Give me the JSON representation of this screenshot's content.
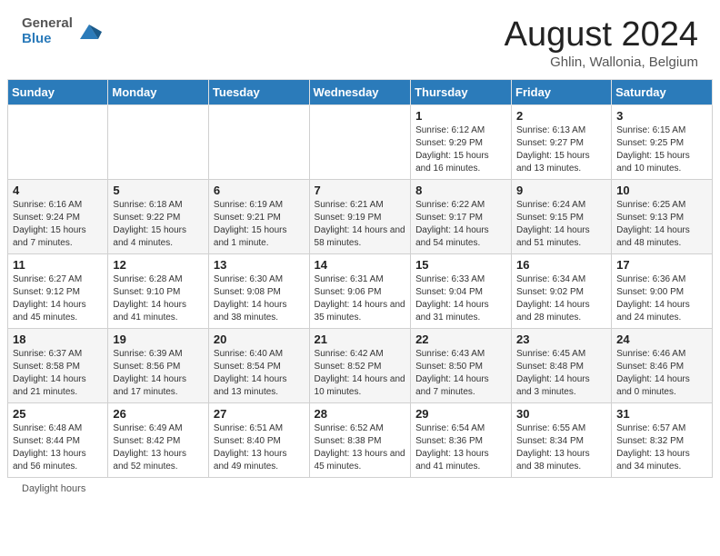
{
  "header": {
    "logo": {
      "general": "General",
      "blue": "Blue"
    },
    "title": "August 2024",
    "location": "Ghlin, Wallonia, Belgium"
  },
  "calendar": {
    "days_of_week": [
      "Sunday",
      "Monday",
      "Tuesday",
      "Wednesday",
      "Thursday",
      "Friday",
      "Saturday"
    ],
    "weeks": [
      [
        {
          "day": "",
          "info": ""
        },
        {
          "day": "",
          "info": ""
        },
        {
          "day": "",
          "info": ""
        },
        {
          "day": "",
          "info": ""
        },
        {
          "day": "1",
          "info": "Sunrise: 6:12 AM\nSunset: 9:29 PM\nDaylight: 15 hours and 16 minutes."
        },
        {
          "day": "2",
          "info": "Sunrise: 6:13 AM\nSunset: 9:27 PM\nDaylight: 15 hours and 13 minutes."
        },
        {
          "day": "3",
          "info": "Sunrise: 6:15 AM\nSunset: 9:25 PM\nDaylight: 15 hours and 10 minutes."
        }
      ],
      [
        {
          "day": "4",
          "info": "Sunrise: 6:16 AM\nSunset: 9:24 PM\nDaylight: 15 hours and 7 minutes."
        },
        {
          "day": "5",
          "info": "Sunrise: 6:18 AM\nSunset: 9:22 PM\nDaylight: 15 hours and 4 minutes."
        },
        {
          "day": "6",
          "info": "Sunrise: 6:19 AM\nSunset: 9:21 PM\nDaylight: 15 hours and 1 minute."
        },
        {
          "day": "7",
          "info": "Sunrise: 6:21 AM\nSunset: 9:19 PM\nDaylight: 14 hours and 58 minutes."
        },
        {
          "day": "8",
          "info": "Sunrise: 6:22 AM\nSunset: 9:17 PM\nDaylight: 14 hours and 54 minutes."
        },
        {
          "day": "9",
          "info": "Sunrise: 6:24 AM\nSunset: 9:15 PM\nDaylight: 14 hours and 51 minutes."
        },
        {
          "day": "10",
          "info": "Sunrise: 6:25 AM\nSunset: 9:13 PM\nDaylight: 14 hours and 48 minutes."
        }
      ],
      [
        {
          "day": "11",
          "info": "Sunrise: 6:27 AM\nSunset: 9:12 PM\nDaylight: 14 hours and 45 minutes."
        },
        {
          "day": "12",
          "info": "Sunrise: 6:28 AM\nSunset: 9:10 PM\nDaylight: 14 hours and 41 minutes."
        },
        {
          "day": "13",
          "info": "Sunrise: 6:30 AM\nSunset: 9:08 PM\nDaylight: 14 hours and 38 minutes."
        },
        {
          "day": "14",
          "info": "Sunrise: 6:31 AM\nSunset: 9:06 PM\nDaylight: 14 hours and 35 minutes."
        },
        {
          "day": "15",
          "info": "Sunrise: 6:33 AM\nSunset: 9:04 PM\nDaylight: 14 hours and 31 minutes."
        },
        {
          "day": "16",
          "info": "Sunrise: 6:34 AM\nSunset: 9:02 PM\nDaylight: 14 hours and 28 minutes."
        },
        {
          "day": "17",
          "info": "Sunrise: 6:36 AM\nSunset: 9:00 PM\nDaylight: 14 hours and 24 minutes."
        }
      ],
      [
        {
          "day": "18",
          "info": "Sunrise: 6:37 AM\nSunset: 8:58 PM\nDaylight: 14 hours and 21 minutes."
        },
        {
          "day": "19",
          "info": "Sunrise: 6:39 AM\nSunset: 8:56 PM\nDaylight: 14 hours and 17 minutes."
        },
        {
          "day": "20",
          "info": "Sunrise: 6:40 AM\nSunset: 8:54 PM\nDaylight: 14 hours and 13 minutes."
        },
        {
          "day": "21",
          "info": "Sunrise: 6:42 AM\nSunset: 8:52 PM\nDaylight: 14 hours and 10 minutes."
        },
        {
          "day": "22",
          "info": "Sunrise: 6:43 AM\nSunset: 8:50 PM\nDaylight: 14 hours and 7 minutes."
        },
        {
          "day": "23",
          "info": "Sunrise: 6:45 AM\nSunset: 8:48 PM\nDaylight: 14 hours and 3 minutes."
        },
        {
          "day": "24",
          "info": "Sunrise: 6:46 AM\nSunset: 8:46 PM\nDaylight: 14 hours and 0 minutes."
        }
      ],
      [
        {
          "day": "25",
          "info": "Sunrise: 6:48 AM\nSunset: 8:44 PM\nDaylight: 13 hours and 56 minutes."
        },
        {
          "day": "26",
          "info": "Sunrise: 6:49 AM\nSunset: 8:42 PM\nDaylight: 13 hours and 52 minutes."
        },
        {
          "day": "27",
          "info": "Sunrise: 6:51 AM\nSunset: 8:40 PM\nDaylight: 13 hours and 49 minutes."
        },
        {
          "day": "28",
          "info": "Sunrise: 6:52 AM\nSunset: 8:38 PM\nDaylight: 13 hours and 45 minutes."
        },
        {
          "day": "29",
          "info": "Sunrise: 6:54 AM\nSunset: 8:36 PM\nDaylight: 13 hours and 41 minutes."
        },
        {
          "day": "30",
          "info": "Sunrise: 6:55 AM\nSunset: 8:34 PM\nDaylight: 13 hours and 38 minutes."
        },
        {
          "day": "31",
          "info": "Sunrise: 6:57 AM\nSunset: 8:32 PM\nDaylight: 13 hours and 34 minutes."
        }
      ]
    ]
  },
  "footer": {
    "daylight_label": "Daylight hours"
  }
}
